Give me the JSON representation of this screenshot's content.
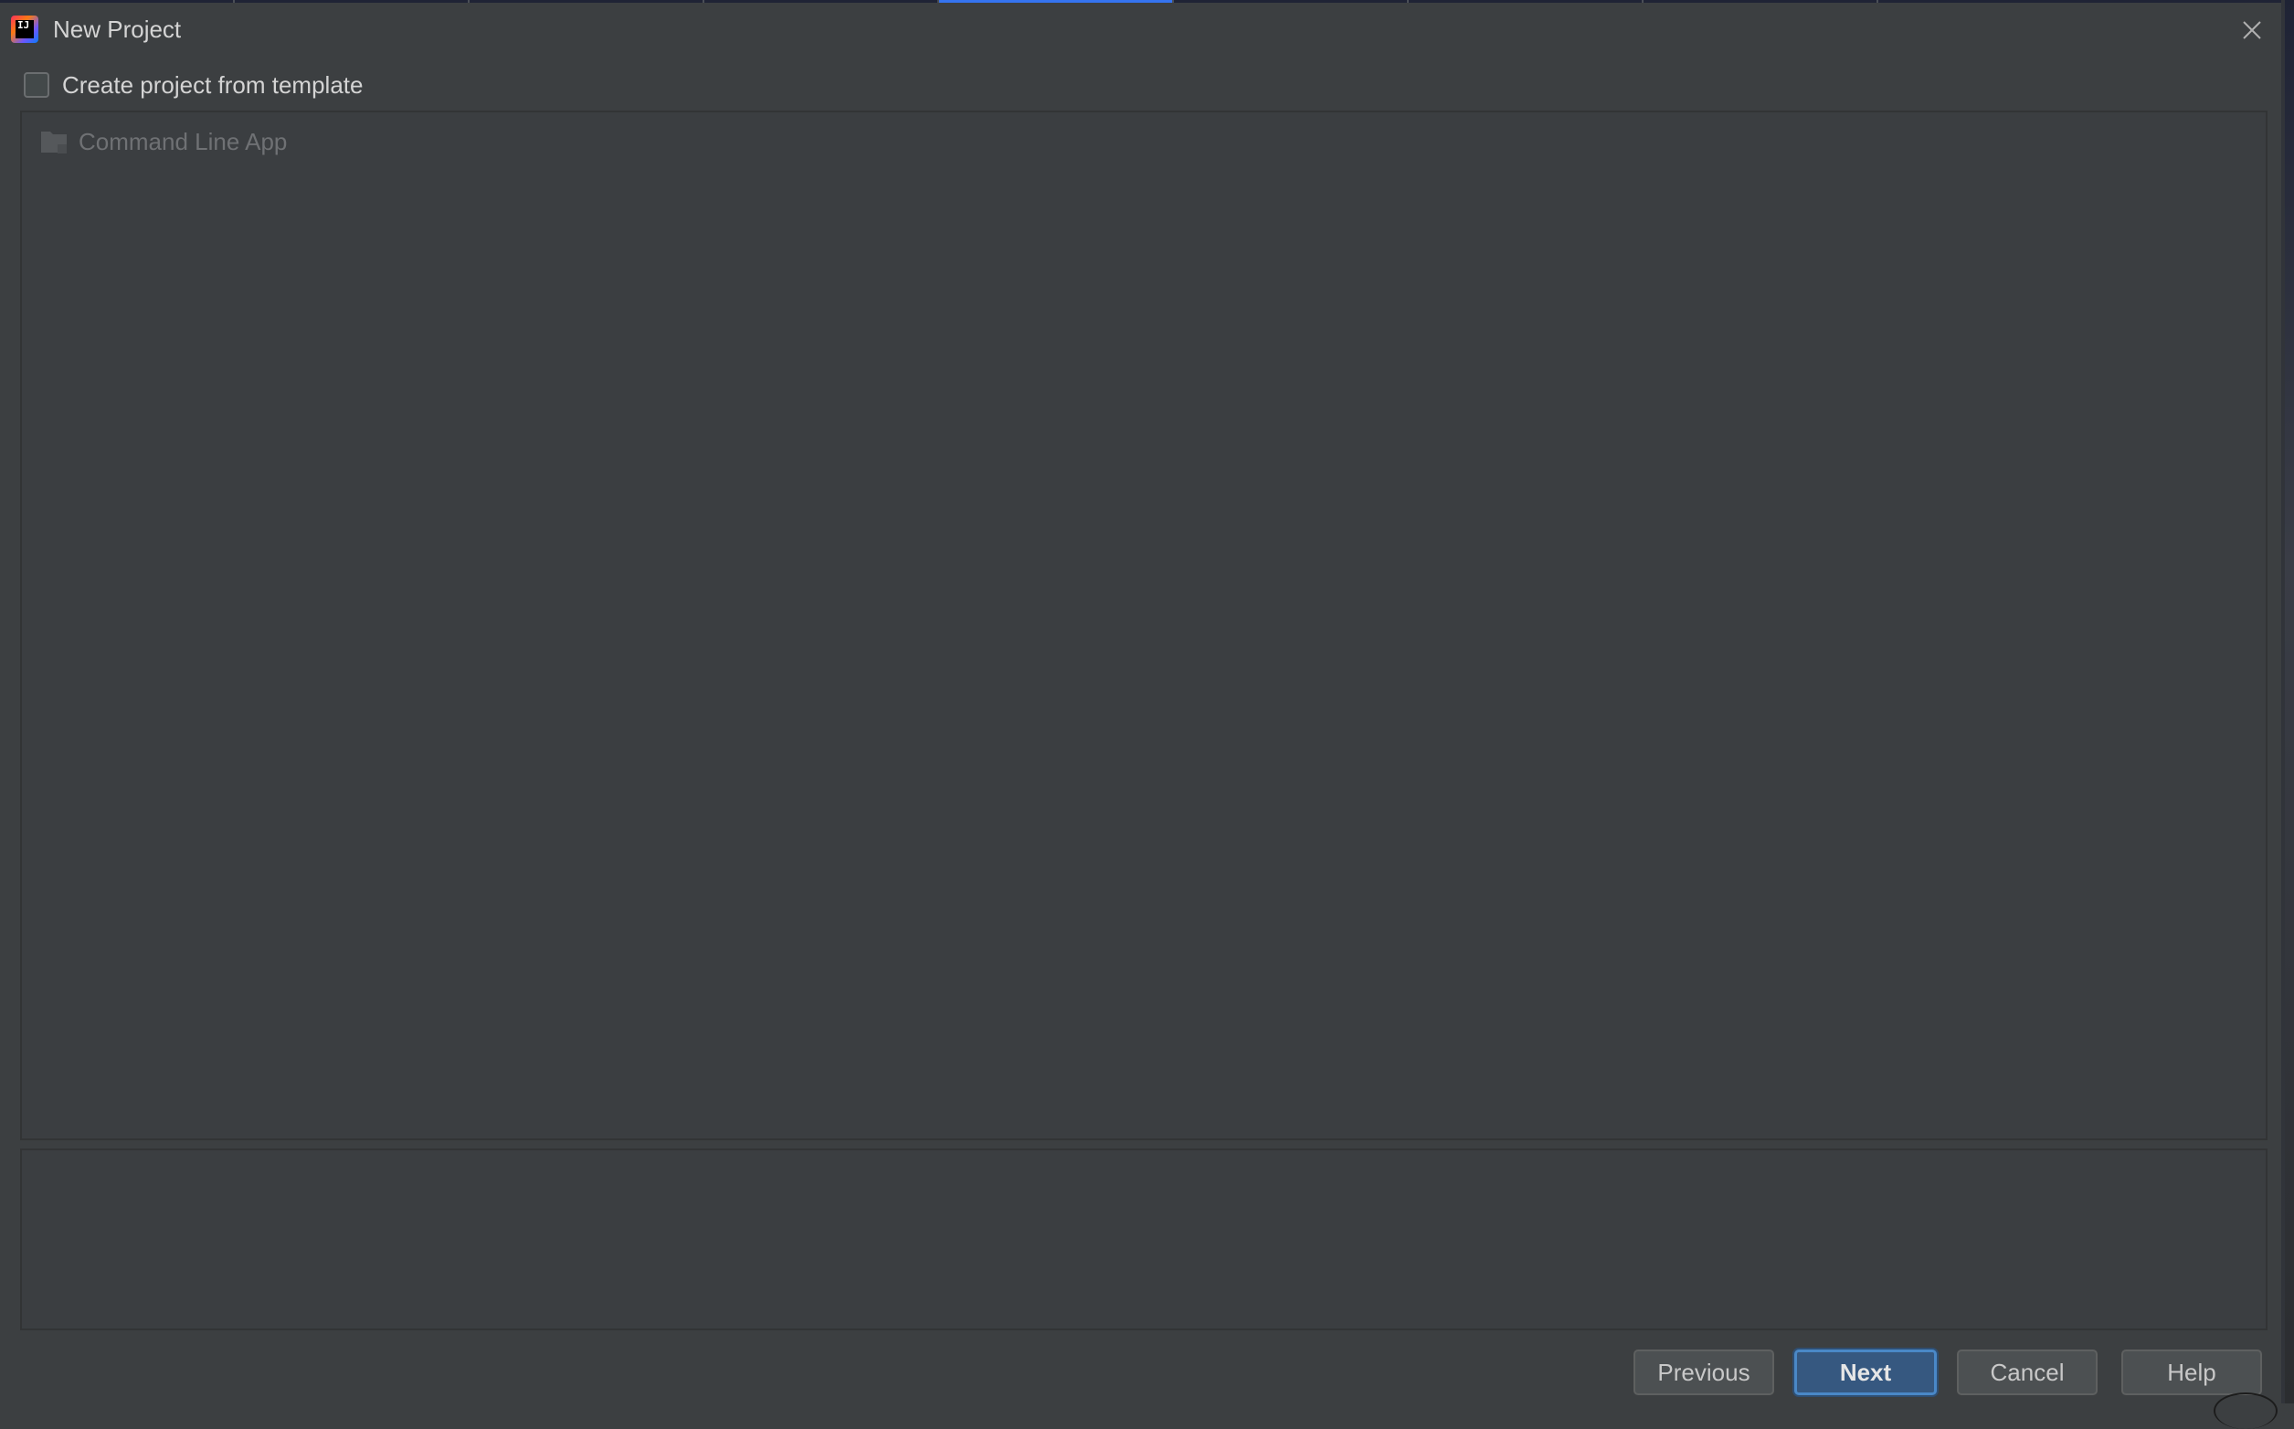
{
  "window": {
    "title": "New Project",
    "app_icon": "intellij-idea-icon",
    "close_icon": "close-icon"
  },
  "options": {
    "create_from_template_label": "Create project from template",
    "create_from_template_checked": false
  },
  "template_list": {
    "items": [
      {
        "label": "Command Line App",
        "icon": "folder-icon",
        "enabled": false
      }
    ]
  },
  "description": {
    "text": ""
  },
  "buttons": {
    "previous": "Previous",
    "next": "Next",
    "cancel": "Cancel",
    "help": "Help"
  },
  "colors": {
    "background": "#3c3f41",
    "accent": "#365880",
    "focus_border": "#4a88c7",
    "tab_active": "#3574f0"
  }
}
